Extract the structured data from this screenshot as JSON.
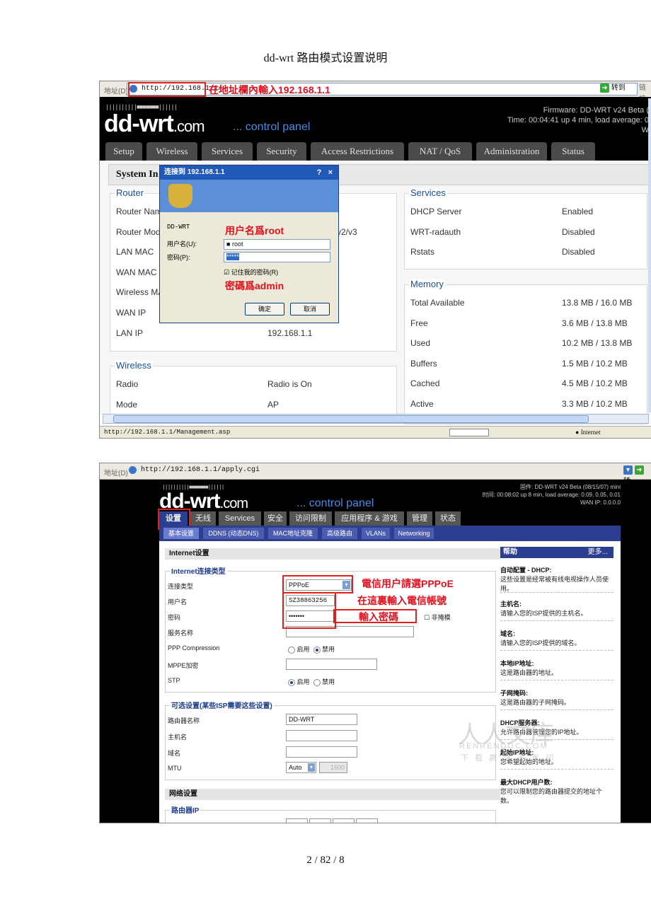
{
  "doc": {
    "title": "dd-wrt 路由模式设置说明",
    "page_number": "2 / 82 / 8"
  },
  "shot1": {
    "address_label": "地址(D)",
    "address_url": "http://192.168.1.1/",
    "address_note": "在地址欄內輸入192.168.1.1",
    "go_label": "转到",
    "links_label": "链接",
    "logo_text": "dd-wrt",
    "logo_suffix": ".com",
    "logo_sub": "... control panel",
    "firmware": "Firmware: DD-WRT v24 Beta (",
    "time": "Time: 00:04:41 up 4 min, load average: 0",
    "wan_cut": "W",
    "tabs": [
      "Setup",
      "Wireless",
      "Services",
      "Security",
      "Access Restrictions",
      "NAT / QoS",
      "Administration",
      "Status"
    ],
    "system_title": "System In",
    "router_legend": "Router",
    "router_rows": [
      {
        "label": "Router Nam",
        "value": ""
      },
      {
        "label": "Router Mod",
        "value": "v2/v3"
      },
      {
        "label": "LAN MAC",
        "value": ""
      },
      {
        "label": "WAN MAC",
        "value": ""
      },
      {
        "label": "Wireless MA",
        "value": ""
      },
      {
        "label": "WAN IP",
        "value": ""
      },
      {
        "label": "LAN IP",
        "value": "192.168.1.1"
      }
    ],
    "wireless_legend": "Wireless",
    "wireless_rows": [
      {
        "label": "Radio",
        "value": "Radio is On"
      },
      {
        "label": "Mode",
        "value": "AP"
      }
    ],
    "services_legend": "Services",
    "services_rows": [
      {
        "label": "DHCP Server",
        "value": "Enabled"
      },
      {
        "label": "WRT-radauth",
        "value": "Disabled"
      },
      {
        "label": "Rstats",
        "value": "Disabled"
      }
    ],
    "memory_legend": "Memory",
    "memory_rows": [
      {
        "label": "Total Available",
        "value": "13.8 MB / 16.0 MB"
      },
      {
        "label": "Free",
        "value": "3.6 MB / 13.8 MB"
      },
      {
        "label": "Used",
        "value": "10.2 MB / 13.8 MB"
      },
      {
        "label": "Buffers",
        "value": "1.5 MB / 10.2 MB"
      },
      {
        "label": "Cached",
        "value": "4.5 MB / 10.2 MB"
      },
      {
        "label": "Active",
        "value": "3.3 MB / 10.2 MB"
      }
    ],
    "dialog": {
      "title": "连接到 192.168.1.1",
      "help": "?",
      "close": "×",
      "realm": "DD-WRT",
      "user_label": "用户名(U):",
      "user_value": "root",
      "pass_label": "密码(P):",
      "pass_value": "*****",
      "remember_label": "记住我的密码(R)",
      "ok": "确定",
      "cancel": "取消",
      "note_user": "用户名爲root",
      "note_pass": "密碼爲admin"
    },
    "status_url": "http://192.168.1.1/Management.asp",
    "status_zone": "Internet"
  },
  "shot2": {
    "address_label": "地址(D)",
    "address_url": "http://192.168.1.1/apply.cgi",
    "go_label": "转",
    "logo_text": "dd-wrt",
    "logo_suffix": ".com",
    "logo_sub": "... control panel",
    "firmware": "固件: DD-WRT v24 Beta (08/15/07) mini",
    "time": "时间: 00:08:02 up 8 min, load average: 0.09, 0.05, 0.01",
    "wan_ip": "WAN IP: 0.0.0.0",
    "nav": [
      "设置",
      "无线",
      "Services",
      "安全",
      "访问限制",
      "应用程序 & 游戏",
      "管理",
      "状态"
    ],
    "subnav": [
      "基本设置",
      "DDNS (动态DNS)",
      "MAC地址克隆",
      "高级路由",
      "VLANs",
      "Networking"
    ],
    "internet_title": "Internet设置",
    "conn_legend": "Internet连接类型",
    "conn_type_label": "连接类型",
    "conn_type_value": "PPPoE",
    "username_label": "用户名",
    "username_value": "SZ38863256",
    "password_label": "密码",
    "password_value": "•••••••",
    "unmask_label": "非掩模",
    "service_label": "服务名称",
    "pppcomp_label": "PPP Compression",
    "mppe_label": "MPPE加密",
    "stp_label": "STP",
    "enable": "启用",
    "disable": "禁用",
    "optional_legend": "可选设置(某些ISP需要这些设置)",
    "router_name_label": "路由器名称",
    "router_name_value": "DD-WRT",
    "hostname_label": "主机名",
    "domain_label": "域名",
    "mtu_label": "MTU",
    "mtu_mode": "Auto",
    "mtu_value": "1500",
    "network_title": "网络设置",
    "router_ip_legend": "路由器IP",
    "note_pppoe": "電信用户請選PPPoE",
    "note_account": "在這裏輸入電信帳號",
    "note_password": "輸入密碼",
    "help_title": "帮助",
    "help_more": "更多...",
    "help_items": [
      {
        "t": "自动配置 - DHCP:",
        "d": "这些设置是经常被有线电视操作人员使用。"
      },
      {
        "t": "主机名:",
        "d": "请输入您的ISP提供的主机名。"
      },
      {
        "t": "域名:",
        "d": "请输入您的ISP提供的域名。"
      },
      {
        "t": "本地IP地址:",
        "d": "这是路由器的地址。"
      },
      {
        "t": "子网掩码:",
        "d": "这是路由器的子网掩码。"
      },
      {
        "t": "DHCP服务器:",
        "d": "允许路由器管理您的IP地址。"
      },
      {
        "t": "起始IP地址:",
        "d": "您希望起始的地址。"
      },
      {
        "t": "最大DHCP用户数:",
        "d": "您可以限制您的路由器提交的地址个数。"
      }
    ],
    "watermark_big": "人人文库",
    "watermark_url": "RENRENDOC.COM",
    "watermark_cn": "下 载 高 清 无 水 印"
  }
}
